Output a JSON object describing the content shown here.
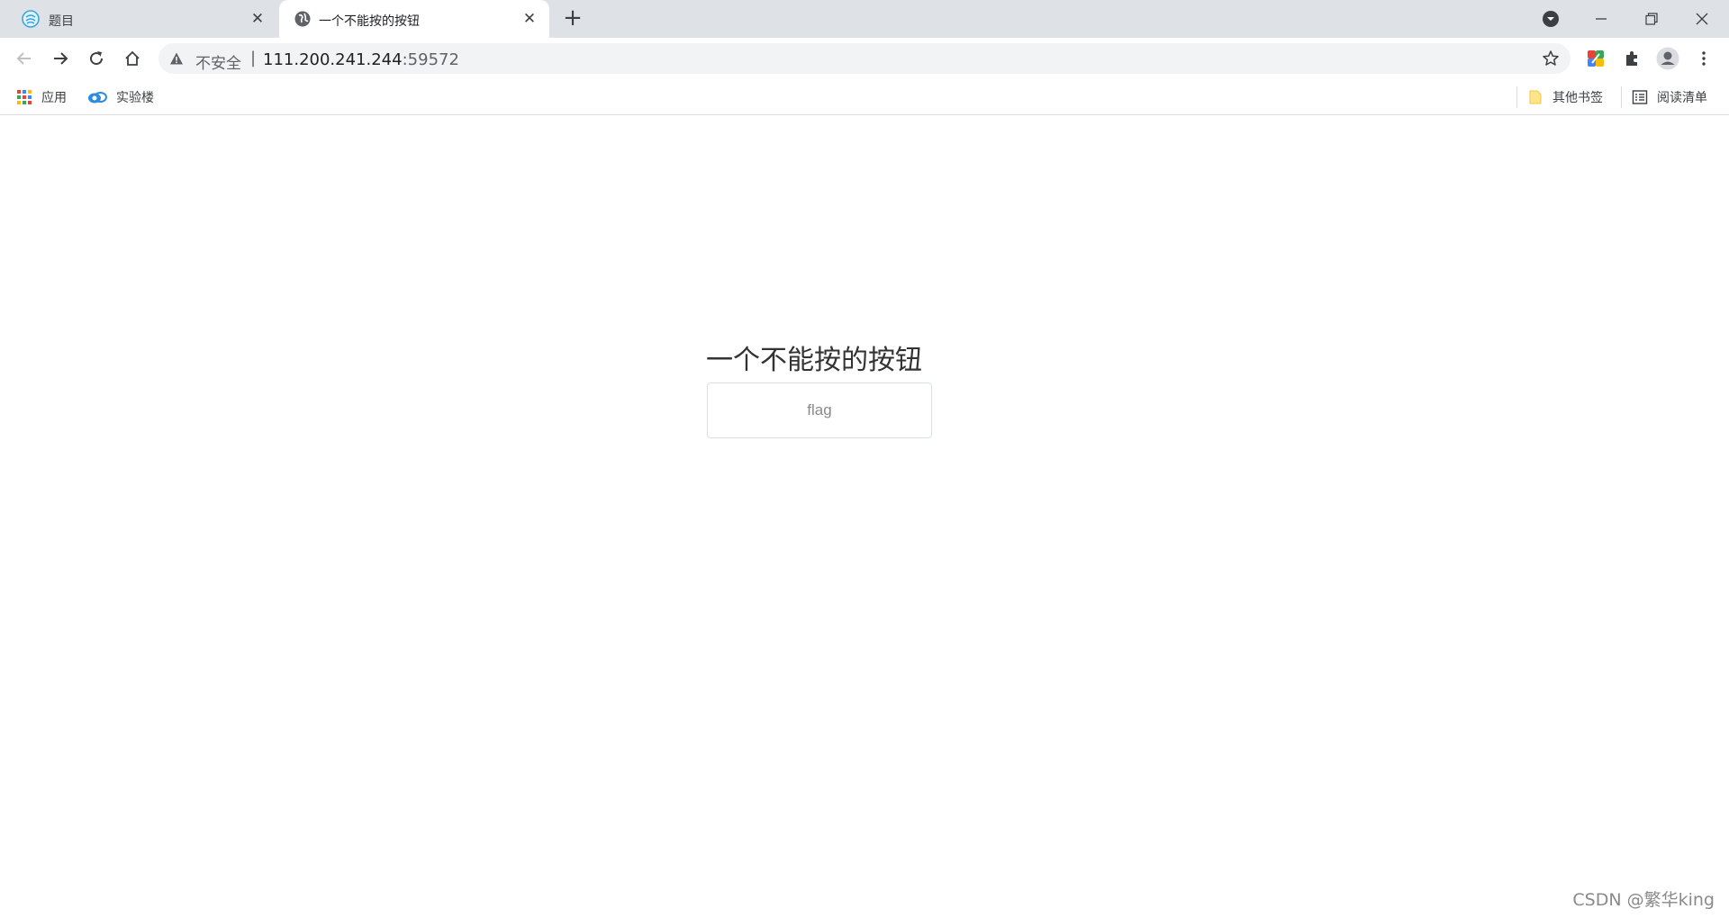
{
  "browser": {
    "tabs": [
      {
        "title": "题目",
        "active": false,
        "favicon": "swirl-logo-icon"
      },
      {
        "title": "一个不能按的按钮",
        "active": true,
        "favicon": "globe-icon"
      }
    ],
    "new_tab_icon": "plus-icon",
    "window_controls": [
      "profile-dropdown-icon",
      "minimize-icon",
      "restore-icon",
      "close-icon"
    ],
    "address_bar": {
      "security_label": "不安全",
      "separator": "|",
      "host": "111.200.241.244",
      "port": ":59572"
    },
    "extensions": [
      "color-extension-icon",
      "puzzle-icon",
      "profile-avatar-icon",
      "kebab-menu-icon"
    ]
  },
  "bookmarks": {
    "left": [
      {
        "label": "应用",
        "icon": "apps-grid-icon"
      },
      {
        "label": "实验楼",
        "icon": "cloud-logo-icon"
      }
    ],
    "right": [
      {
        "label": "其他书签",
        "icon": "folder-icon"
      },
      {
        "label": "阅读清单",
        "icon": "reading-list-icon"
      }
    ]
  },
  "page": {
    "heading": "一个不能按的按钮",
    "button_label": "flag"
  },
  "watermark": "CSDN @繁华king",
  "colors": {
    "tabstrip": "#dee1e6",
    "omnibox": "#f1f3f4",
    "button_border": "#dcdfe6"
  }
}
